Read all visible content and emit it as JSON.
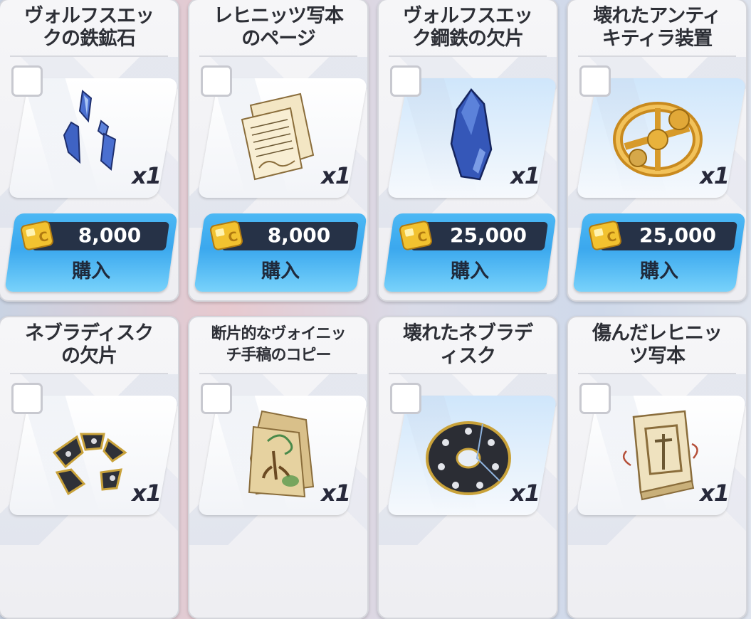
{
  "items": [
    {
      "title": "ヴォルフスエック の鉄鉱石",
      "title_lines": [
        "ヴォルフスエッ",
        "クの鉄鉱石"
      ],
      "quantity": "x1",
      "price": "8,000",
      "buy_label": "購入",
      "icon": "iron-ore-icon",
      "tile": "white"
    },
    {
      "title": "レヒニッツ写本のページ",
      "title_lines": [
        "レヒニッツ写本",
        "のページ"
      ],
      "quantity": "x1",
      "price": "8,000",
      "buy_label": "購入",
      "icon": "manuscript-page-icon",
      "tile": "white"
    },
    {
      "title": "ヴォルフスエック鋼鉄の欠片",
      "title_lines": [
        "ヴォルフスエッ",
        "ク鋼鉄の欠片"
      ],
      "quantity": "x1",
      "price": "25,000",
      "buy_label": "購入",
      "icon": "steel-shard-icon",
      "tile": "blue"
    },
    {
      "title": "壊れたアンティキティラ装置",
      "title_lines": [
        "壊れたアンティ",
        "キティラ装置"
      ],
      "quantity": "x1",
      "price": "25,000",
      "buy_label": "購入",
      "icon": "antikythera-device-icon",
      "tile": "blue"
    },
    {
      "title": "ネブラディスクの欠片",
      "title_lines": [
        "ネブラディスク",
        "の欠片"
      ],
      "quantity": "x1",
      "icon": "disk-fragment-icon",
      "tile": "white"
    },
    {
      "title": "断片的なヴォイニッチ手稿のコピー",
      "title_lines": [
        "断片的なヴォイニッ",
        "チ手稿のコピー"
      ],
      "quantity": "x1",
      "icon": "voynich-copy-icon",
      "tile": "white",
      "small": true
    },
    {
      "title": "壊れたネブラディスク",
      "title_lines": [
        "壊れたネブラデ",
        "ィスク"
      ],
      "quantity": "x1",
      "icon": "broken-disk-icon",
      "tile": "blue"
    },
    {
      "title": "傷んだレヒニッツ写本",
      "title_lines": [
        "傷んだレヒニッ",
        "ツ写本"
      ],
      "quantity": "x1",
      "icon": "damaged-codex-icon",
      "tile": "white"
    }
  ],
  "colors": {
    "buy_button": "#3ba8ee",
    "price_bar": "#263247",
    "coin": "#f2c230"
  }
}
